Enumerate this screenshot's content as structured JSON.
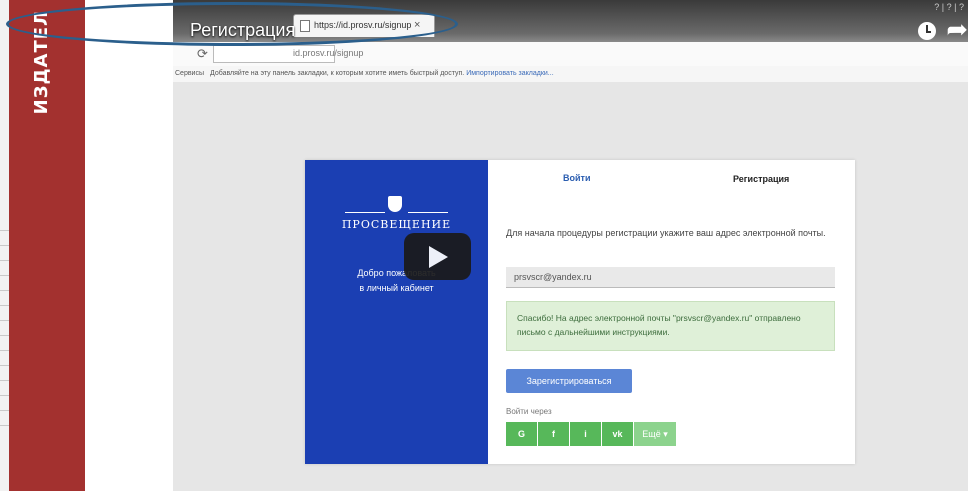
{
  "slide": {
    "vertical_text": "ИЗДАТЕЛ"
  },
  "video": {
    "title": "Регистрация",
    "top_right_text": "? | ? | ?"
  },
  "browser": {
    "tab_title": "https://id.prosv.ru/signup",
    "tab_close": "×",
    "address": "id.prosv.ru/signup",
    "bookmarks_label": "Сервисы",
    "bookmarks_hint": "Добавляйте на эту панель закладки, к которым хотите иметь быстрый доступ.",
    "bookmarks_import": "Импортировать закладки..."
  },
  "card": {
    "logo_text": "ПРОСВЕЩЕНИЕ",
    "welcome_line1": "Добро пожаловать",
    "welcome_line2": "в личный кабинет",
    "tab_login": "Войти",
    "tab_register": "Регистрация",
    "instruction": "Для начала процедуры регистрации укажите ваш адрес электронной почты.",
    "email_value": "prsvscr@yandex.ru",
    "alert_text": "Спасибо! На адрес электронной почты \"prsvscr@yandex.ru\" отправлено письмо с дальнейшими инструкциями.",
    "register_button": "Зарегистрироваться",
    "login_via": "Войти через",
    "social": {
      "google": "G",
      "facebook": "f",
      "odnoklassniki": "i",
      "vk": "vk",
      "more": "Ещё ▾"
    }
  },
  "colors": {
    "red_band": "#a3312f",
    "blue_panel": "#1b3fb3",
    "social_green": "#57b85a",
    "register_blue": "#5b86d6",
    "oval": "#2b5f8c"
  }
}
